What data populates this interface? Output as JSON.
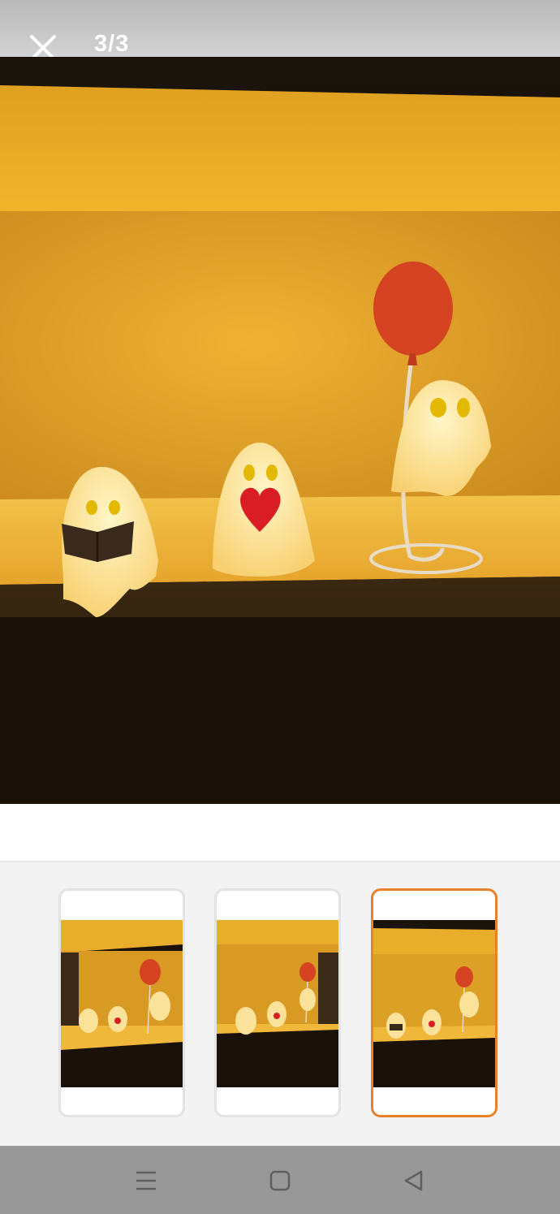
{
  "viewer": {
    "counter": "3/3",
    "close_icon": "close-icon",
    "selected_index": 3
  },
  "thumbnails": [
    {
      "name": "photo-1",
      "selected": false
    },
    {
      "name": "photo-2",
      "selected": false
    },
    {
      "name": "photo-3",
      "selected": true
    }
  ],
  "navbar": {
    "icons": [
      "menu-icon",
      "home-icon",
      "back-icon"
    ]
  },
  "colors": {
    "accent": "#e8812a",
    "topbar": "#c4c4c4",
    "navbar": "#989898"
  }
}
